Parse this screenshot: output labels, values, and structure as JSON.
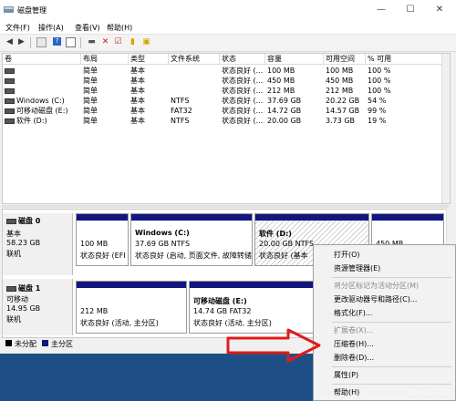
{
  "window": {
    "title": "磁盘管理",
    "minimize": "—",
    "maximize": "☐",
    "close": "✕"
  },
  "menu": [
    {
      "label": "文件(F)"
    },
    {
      "label": "操作(A)"
    },
    {
      "label": "查看(V)"
    },
    {
      "label": "帮助(H)"
    }
  ],
  "toolbar": {
    "icons": [
      "back-icon",
      "forward-icon",
      "properties-icon",
      "help-icon",
      "help-panel-icon",
      "connect-icon",
      "delete-icon",
      "check-icon",
      "new-icon",
      "open-icon"
    ]
  },
  "volumes": {
    "headers": [
      "卷",
      "布局",
      "类型",
      "文件系统",
      "状态",
      "容量",
      "可用空间",
      "% 可用"
    ],
    "rows": [
      [
        "",
        "简单",
        "基本",
        "",
        "状态良好 (...",
        "100 MB",
        "100 MB",
        "100 %"
      ],
      [
        "",
        "简单",
        "基本",
        "",
        "状态良好 (...",
        "450 MB",
        "450 MB",
        "100 %"
      ],
      [
        "",
        "简单",
        "基本",
        "",
        "状态良好 (...",
        "212 MB",
        "212 MB",
        "100 %"
      ],
      [
        "Windows (C:)",
        "简单",
        "基本",
        "NTFS",
        "状态良好 (...",
        "37.69 GB",
        "20.22 GB",
        "54 %"
      ],
      [
        "可移动磁盘 (E:)",
        "简单",
        "基本",
        "FAT32",
        "状态良好 (...",
        "14.72 GB",
        "14.57 GB",
        "99 %"
      ],
      [
        "软件 (D:)",
        "简单",
        "基本",
        "NTFS",
        "状态良好 (...",
        "20.00 GB",
        "3.73 GB",
        "19 %"
      ]
    ]
  },
  "disks": [
    {
      "name": "磁盘 0",
      "type": "基本",
      "size": "58.23 GB",
      "status": "联机",
      "partitions": [
        {
          "title": "",
          "line1": "100 MB",
          "line2": "状态良好 (EFI"
        },
        {
          "title": "Windows  (C:)",
          "line1": "37.69 GB NTFS",
          "line2": "状态良好 (启动, 页面文件, 故障转储"
        },
        {
          "title": "软件  (D:)",
          "line1": "20.00 GB NTFS",
          "line2": "状态良好 (基本"
        },
        {
          "title": "",
          "line1": "450 MB",
          "line2": ""
        }
      ]
    },
    {
      "name": "磁盘 1",
      "type": "可移动",
      "size": "14.95 GB",
      "status": "联机",
      "partitions": [
        {
          "title": "",
          "line1": "212 MB",
          "line2": "状态良好 (活动, 主分区)"
        },
        {
          "title": "可移动磁盘  (E:)",
          "line1": "14.74 GB FAT32",
          "line2": "状态良好 (活动, 主分区)"
        }
      ]
    }
  ],
  "legend": [
    {
      "label": "未分配",
      "color": "#000000"
    },
    {
      "label": "主分区",
      "color": "#14167f"
    }
  ],
  "context_menu": [
    {
      "label": "打开(O)",
      "enabled": true
    },
    {
      "label": "资源管理器(E)",
      "enabled": true
    },
    {
      "label": "将分区标记为活动分区(M)",
      "enabled": false
    },
    {
      "label": "更改驱动器号和路径(C)...",
      "enabled": true
    },
    {
      "label": "格式化(F)...",
      "enabled": true
    },
    {
      "label": "扩展卷(X)...",
      "enabled": false
    },
    {
      "label": "压缩卷(H)...",
      "enabled": true
    },
    {
      "label": "删除卷(D)...",
      "enabled": true
    },
    {
      "label": "属性(P)",
      "enabled": true
    },
    {
      "label": "帮助(H)",
      "enabled": true
    }
  ],
  "colors": {
    "partition_bar": "#14167f",
    "arrow": "#e01b1b"
  },
  "watermark": "Baidu 经验"
}
